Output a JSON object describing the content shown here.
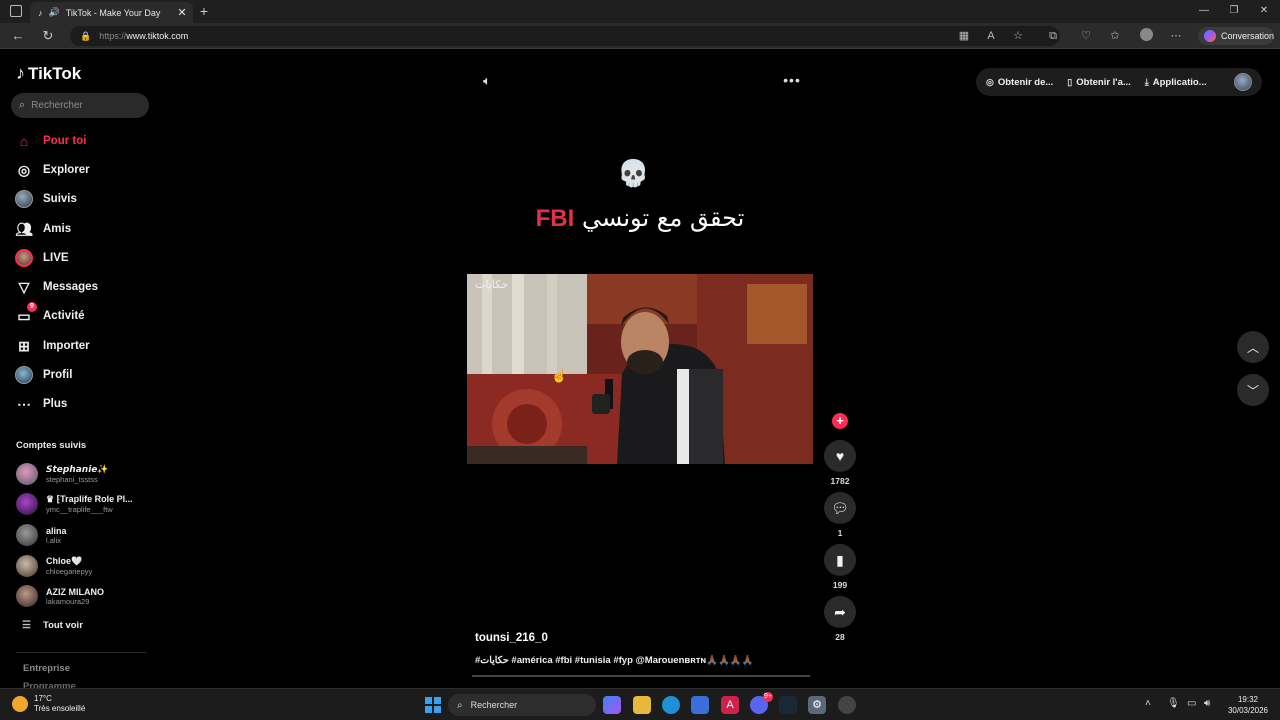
{
  "browser": {
    "tab_title": "TikTok - Make Your Day",
    "tab_close": "✕",
    "new_tab": "+",
    "url_scheme": "https://",
    "url_host": "www.tiktok.com",
    "conversation_label": "Conversation",
    "window_controls": [
      "—",
      "❐",
      "✕"
    ]
  },
  "sidebar": {
    "logo_text": "TikTok",
    "search_placeholder": "Rechercher",
    "items": [
      {
        "label": "Pour toi",
        "icon": "home-icon"
      },
      {
        "label": "Explorer",
        "icon": "compass-icon"
      },
      {
        "label": "Suivis",
        "icon": "following-avatar-icon"
      },
      {
        "label": "Amis",
        "icon": "friends-icon"
      },
      {
        "label": "LIVE",
        "icon": "live-icon"
      },
      {
        "label": "Messages",
        "icon": "send-icon"
      },
      {
        "label": "Activité",
        "icon": "activity-icon",
        "badge": "9"
      },
      {
        "label": "Importer",
        "icon": "upload-icon"
      },
      {
        "label": "Profil",
        "icon": "profile-avatar-icon"
      },
      {
        "label": "Plus",
        "icon": "more-icon"
      }
    ],
    "following_title": "Comptes suivis",
    "accounts": [
      {
        "name": "𝙎𝙩𝙚𝙥𝙝𝙖𝙣𝙞𝙚✨",
        "handle": "stephani_tsstss"
      },
      {
        "name": "♛ ⁅Traplife Role Pl...",
        "handle": "ymc__traplife___ftw"
      },
      {
        "name": "alina",
        "handle": "l.alix"
      },
      {
        "name": "Chloe🤍",
        "handle": "chloegariepyy"
      },
      {
        "name": "AZIZ MILANO",
        "handle": "lakamoura29"
      }
    ],
    "see_all": "Tout voir",
    "footer_1": "Entreprise",
    "footer_2": "Programme"
  },
  "top_actions": [
    {
      "label": "Obtenir de...",
      "icon": "coin-icon"
    },
    {
      "label": "Obtenir l'a...",
      "icon": "phone-icon"
    },
    {
      "label": "Applicatio...",
      "icon": "download-icon"
    }
  ],
  "post": {
    "skull": "💀",
    "caption_arabic": "تحقق مع تونسي",
    "caption_fbi": "FBI",
    "username": "tounsi_216_0",
    "hashtags": "#حكايات #américa #fbi #tunisia #fyp @Marouenʙʀᴛɴ🙏🏾🙏🏾🙏🏾🙏🏾",
    "watermark": "حكايات"
  },
  "rail": {
    "likes": "1782",
    "comments": "1",
    "saves": "199",
    "shares": "28"
  },
  "taskbar": {
    "temp": "17°C",
    "weather": "Très ensoleillé",
    "search": "Rechercher",
    "time": "19:32",
    "date": "30/03/2026",
    "discord_badge": "9+"
  }
}
